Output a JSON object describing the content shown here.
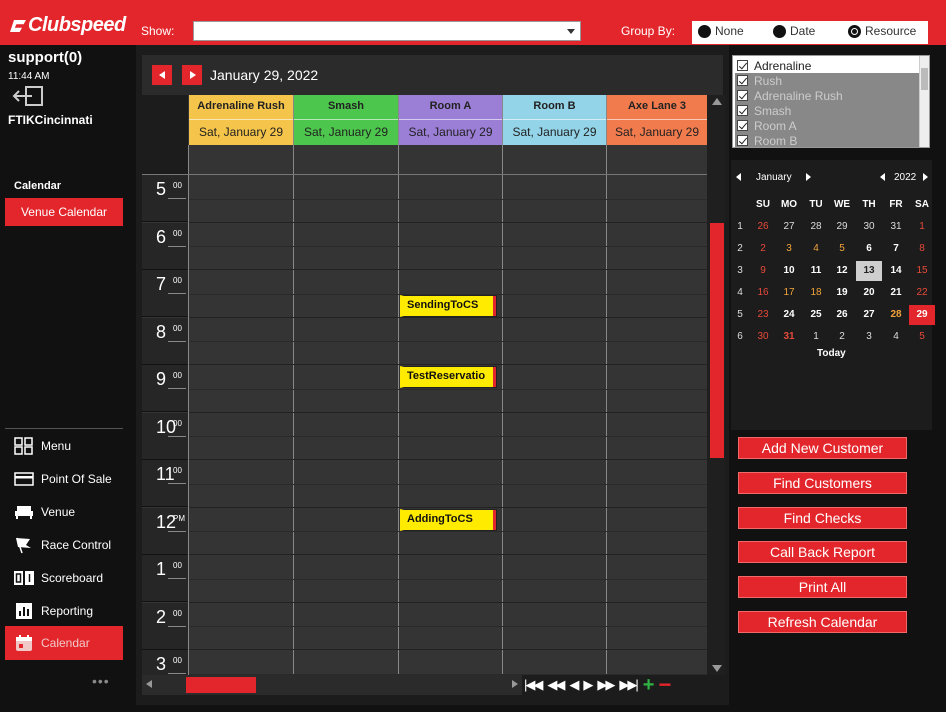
{
  "brand": "Clubspeed",
  "topbar": {
    "show_label": "Show:",
    "show_value": "",
    "group_by_label": "Group By:",
    "group_options": [
      {
        "label": "None",
        "selected": false
      },
      {
        "label": "Date",
        "selected": false
      },
      {
        "label": "Resource",
        "selected": true
      }
    ]
  },
  "sidebar": {
    "user": "support(0)",
    "time": "11:44 AM",
    "site": "FTIKCincinnati",
    "section_label": "Calendar",
    "venue_calendar": "Venue Calendar",
    "nav": [
      {
        "label": "Menu",
        "icon": "grid-icon"
      },
      {
        "label": "Point Of Sale",
        "icon": "card-icon"
      },
      {
        "label": "Venue",
        "icon": "sofa-icon"
      },
      {
        "label": "Race Control",
        "icon": "flag-icon"
      },
      {
        "label": "Scoreboard",
        "icon": "scoreboard-icon"
      },
      {
        "label": "Reporting",
        "icon": "chart-icon"
      },
      {
        "label": "Calendar",
        "icon": "calendar-icon",
        "active": true
      }
    ],
    "more": "•••"
  },
  "calendar": {
    "date_title": "January 29, 2022",
    "resources": [
      {
        "name": "Adrenaline Rush",
        "date": "Sat, January 29",
        "color": "#f5c44a"
      },
      {
        "name": "Smash",
        "date": "Sat, January 29",
        "color": "#4cc64c"
      },
      {
        "name": "Room A",
        "date": "Sat, January 29",
        "color": "#9b7fd6"
      },
      {
        "name": "Room B",
        "date": "Sat, January 29",
        "color": "#93d4e8"
      },
      {
        "name": "Axe Lane 3",
        "date": "Sat, January 29",
        "color": "#f27b4e"
      }
    ],
    "hours": [
      {
        "h": "5",
        "m": "00"
      },
      {
        "h": "6",
        "m": "00"
      },
      {
        "h": "7",
        "m": "00"
      },
      {
        "h": "8",
        "m": "00"
      },
      {
        "h": "9",
        "m": "00"
      },
      {
        "h": "10",
        "m": "00"
      },
      {
        "h": "11",
        "m": "00"
      },
      {
        "h": "12",
        "m": "PM"
      },
      {
        "h": "1",
        "m": "00"
      },
      {
        "h": "2",
        "m": "00"
      },
      {
        "h": "3",
        "m": "00"
      }
    ],
    "events": [
      {
        "label": "SendingToCS",
        "resource": 2,
        "hour_index": 2.5
      },
      {
        "label": "TestReservatio",
        "resource": 2,
        "hour_index": 4.0
      },
      {
        "label": "AddingToCS",
        "resource": 2,
        "hour_index": 7.0
      }
    ],
    "pager": {
      "first": "|◀◀",
      "prev_page": "◀◀",
      "prev": "◀",
      "next": "▶",
      "next_page": "▶▶",
      "last": "▶▶|"
    }
  },
  "resource_filter": [
    {
      "label": "Adrenaline",
      "checked": true
    },
    {
      "label": "Rush",
      "checked": true
    },
    {
      "label": "Adrenaline Rush",
      "checked": true
    },
    {
      "label": "Smash",
      "checked": true
    },
    {
      "label": "Room A",
      "checked": true
    },
    {
      "label": "Room B",
      "checked": true
    }
  ],
  "mini_calendar": {
    "month": "January",
    "year": "2022",
    "weekdays": [
      "SU",
      "MO",
      "TU",
      "WE",
      "TH",
      "FR",
      "SA"
    ],
    "weeks": [
      {
        "wk": "1",
        "days": [
          "26",
          "27",
          "28",
          "29",
          "30",
          "31",
          "1"
        ]
      },
      {
        "wk": "2",
        "days": [
          "2",
          "3",
          "4",
          "5",
          "6",
          "7",
          "8"
        ]
      },
      {
        "wk": "3",
        "days": [
          "9",
          "10",
          "11",
          "12",
          "13",
          "14",
          "15"
        ]
      },
      {
        "wk": "4",
        "days": [
          "16",
          "17",
          "18",
          "19",
          "20",
          "21",
          "22"
        ]
      },
      {
        "wk": "5",
        "days": [
          "23",
          "24",
          "25",
          "26",
          "27",
          "28",
          "29"
        ]
      },
      {
        "wk": "6",
        "days": [
          "30",
          "31",
          "1",
          "2",
          "3",
          "4",
          "5"
        ]
      }
    ],
    "today_label": "Today",
    "selected_day": "29",
    "highlight_day": "13"
  },
  "actions": [
    "Add New Customer",
    "Find Customers",
    "Find Checks",
    "Call Back Report",
    "Print All",
    "Refresh Calendar"
  ],
  "colors": {
    "accent": "#e3262b",
    "event": "#ffeb00",
    "weekend": "#e8493a",
    "other_month": "#e8493a"
  }
}
